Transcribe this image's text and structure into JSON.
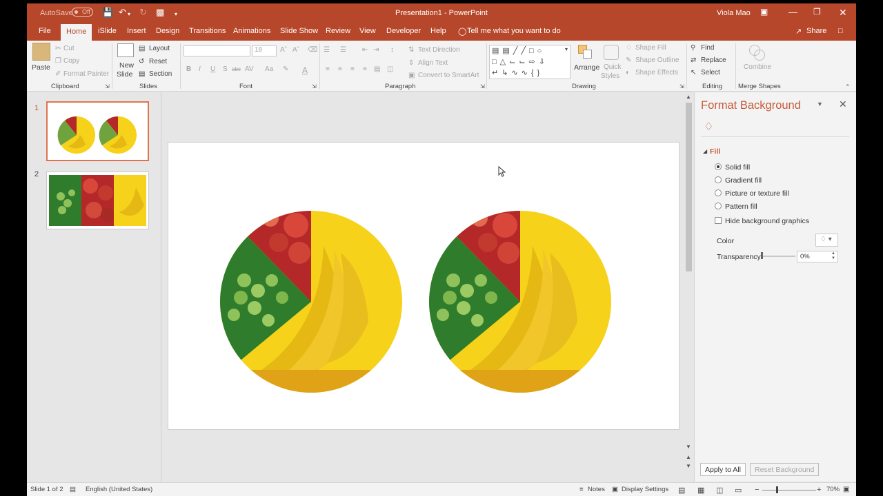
{
  "titlebar": {
    "autosave_label": "AutoSave",
    "autosave_state": "Off",
    "document_title": "Presentation1  -  PowerPoint",
    "user_name": "Viola Mao"
  },
  "tabs": [
    "File",
    "Home",
    "iSlide",
    "Insert",
    "Design",
    "Transitions",
    "Animations",
    "Slide Show",
    "Review",
    "View",
    "Developer",
    "Help"
  ],
  "tell_me": "Tell me what you want to do",
  "share_label": "Share",
  "ribbon": {
    "clipboard": {
      "paste": "Paste",
      "cut": "Cut",
      "copy": "Copy",
      "format_painter": "Format Painter",
      "label": "Clipboard"
    },
    "slides": {
      "new_slide_1": "New",
      "new_slide_2": "Slide",
      "layout": "Layout",
      "reset": "Reset",
      "section": "Section",
      "label": "Slides"
    },
    "font": {
      "font_size": "18",
      "bold": "B",
      "italic": "I",
      "underline": "U",
      "strike": "S",
      "shadow": "abc",
      "spacing": "AV",
      "case": "Aa",
      "color": "A",
      "label": "Font"
    },
    "paragraph": {
      "text_direction": "Text Direction",
      "align_text": "Align Text",
      "convert_smartart": "Convert to SmartArt",
      "label": "Paragraph"
    },
    "drawing": {
      "arrange": "Arrange",
      "quick_1": "Quick",
      "quick_2": "Styles",
      "shape_fill": "Shape Fill",
      "shape_outline": "Shape Outline",
      "shape_effects": "Shape Effects",
      "label": "Drawing"
    },
    "editing": {
      "find": "Find",
      "replace": "Replace",
      "select": "Select",
      "label": "Editing"
    },
    "merge": {
      "combine": "Combine",
      "label": "Merge Shapes"
    }
  },
  "thumbnails": [
    {
      "number": "1"
    },
    {
      "number": "2"
    }
  ],
  "format_pane": {
    "title": "Format Background",
    "section": "Fill",
    "options": [
      "Solid fill",
      "Gradient fill",
      "Picture or texture fill",
      "Pattern fill"
    ],
    "selected_option": "Solid fill",
    "hide_graphics": "Hide background graphics",
    "color_label": "Color",
    "transparency_label": "Transparency",
    "transparency_value": "0%",
    "apply_all": "Apply to All",
    "reset_background": "Reset Background"
  },
  "status": {
    "slide_info": "Slide 1 of 2",
    "language": "English (United States)",
    "notes": "Notes",
    "display_settings": "Display Settings",
    "zoom": "70%"
  },
  "colors": {
    "accent": "#b7472a",
    "pane_title": "#c55a3a",
    "banana": "#f6d21b",
    "apple": "#b5282a",
    "grape": "#6fa33e",
    "leaf": "#2f7d2c"
  }
}
